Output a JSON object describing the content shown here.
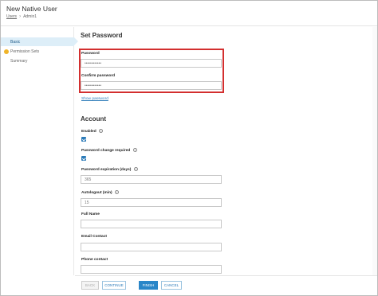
{
  "window": {
    "title": "New Native User"
  },
  "breadcrumb": {
    "parent": "Users",
    "current": "Admin1"
  },
  "sidebar": {
    "items": [
      {
        "label": "Basic",
        "active": true
      },
      {
        "label": "Permission Sets",
        "warning": true
      },
      {
        "label": "Summary"
      }
    ]
  },
  "set_password": {
    "heading": "Set Password",
    "password_label": "Password",
    "password_value": "••••••••••••",
    "confirm_label": "Confirm password",
    "confirm_value": "••••••••••••",
    "show_password_link": "Show password"
  },
  "account": {
    "heading": "Account",
    "enabled_label": "Enabled",
    "enabled_checked": true,
    "pw_change_label": "Password change required",
    "pw_change_checked": true,
    "pw_expiration_label": "Password expiration (days)",
    "pw_expiration_value": "365",
    "autologout_label": "Autologout (min)",
    "autologout_value": "15",
    "full_name_label": "Full Name",
    "full_name_value": "",
    "email_label": "Email Contact",
    "email_value": "",
    "phone_label": "Phone contact",
    "phone_value": ""
  },
  "footer": {
    "back": "BACK",
    "continue": "CONTINUE",
    "finish": "FINISH",
    "cancel": "CANCEL"
  },
  "colors": {
    "accent": "#2a7ab8",
    "highlight_border": "#d32f2f",
    "warning": "#f0b429",
    "active_nav_bg": "#ddeef8"
  }
}
